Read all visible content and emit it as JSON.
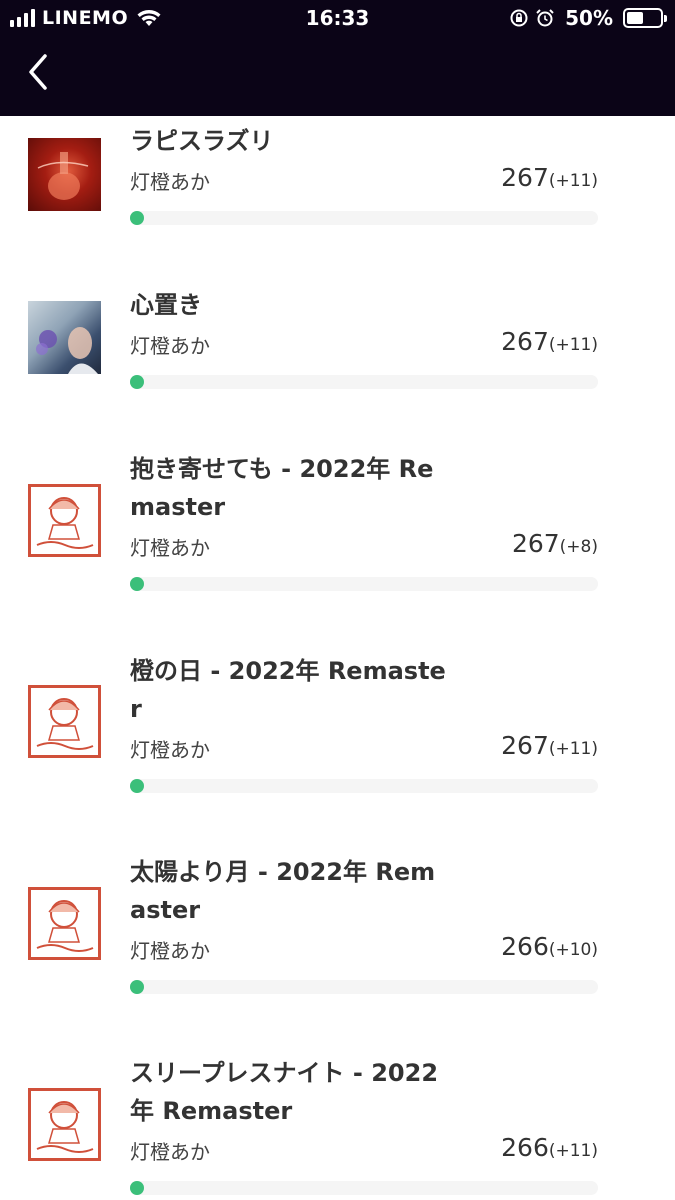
{
  "status_bar": {
    "carrier": "LINEMO",
    "time": "16:33",
    "battery_percent": "50%",
    "battery_level": 0.5
  },
  "header": {
    "back_icon": "chevron-left-icon"
  },
  "tracks": [
    {
      "title": "ラピスラズリ",
      "artist": "灯橙あか",
      "count": "267",
      "delta": "(+11)",
      "progress": 0.02,
      "cover": "red"
    },
    {
      "title": "心置き",
      "artist": "灯橙あか",
      "count": "267",
      "delta": "(+11)",
      "progress": 0.02,
      "cover": "photo"
    },
    {
      "title": "抱き寄せても - 2022年 Remaster",
      "artist": "灯橙あか",
      "count": "267",
      "delta": "(+8)",
      "progress": 0.02,
      "cover": "illust"
    },
    {
      "title": "橙の日 - 2022年 Remaster",
      "artist": "灯橙あか",
      "count": "267",
      "delta": "(+11)",
      "progress": 0.02,
      "cover": "illust"
    },
    {
      "title": "太陽より月 - 2022年 Remaster",
      "artist": "灯橙あか",
      "count": "266",
      "delta": "(+10)",
      "progress": 0.02,
      "cover": "illust"
    },
    {
      "title": "スリープレスナイト - 2022年 Remaster",
      "artist": "灯橙あか",
      "count": "266",
      "delta": "(+11)",
      "progress": 0.02,
      "cover": "illust"
    }
  ],
  "colors": {
    "header_bg": "#0b0417",
    "progress_fill": "#3bbf7a",
    "progress_track": "#f5f5f5"
  }
}
